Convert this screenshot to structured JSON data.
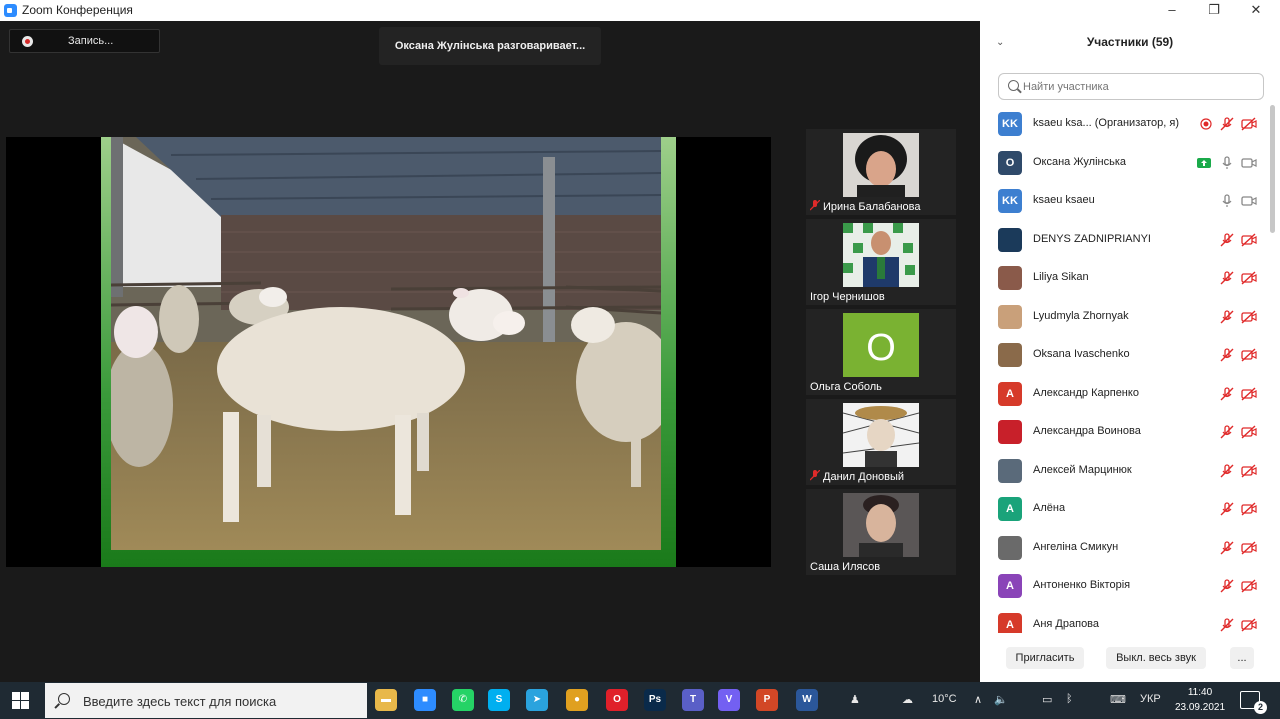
{
  "window": {
    "title": "Zoom Конференция",
    "controls": [
      "–",
      "❐",
      "✕"
    ]
  },
  "meeting": {
    "recording_label": "Запись...",
    "speaking_indicator": "Оксана Жулінська разговаривает..."
  },
  "gallery": [
    {
      "name": "Ирина Балабанова",
      "muted": true,
      "avatar": "photo-woman"
    },
    {
      "name": "Ігор Чернишов",
      "muted": false,
      "avatar": "photo-man-green"
    },
    {
      "name": "Ольга Соболь",
      "muted": false,
      "avatar": "letter",
      "letter": "О",
      "color": "#7ab232"
    },
    {
      "name": "Данил Доновый",
      "muted": true,
      "avatar": "photo-sketch"
    },
    {
      "name": "Саша Илясов",
      "muted": false,
      "avatar": "photo-young-man"
    }
  ],
  "participants_panel": {
    "title": "Участники (59)",
    "search_placeholder": "Найти участника",
    "participants": [
      {
        "name": "ksaeu ksa... (Организатор, я)",
        "initials": "KK",
        "color": "#3d7fd0",
        "recording": true,
        "mic": "muted",
        "video": "off"
      },
      {
        "name": "Оксана Жулінська",
        "initials": "O",
        "color": "#2f4a6a",
        "sharing": true,
        "mic": "on",
        "video": "on"
      },
      {
        "name": "ksaeu ksaeu",
        "initials": "KK",
        "color": "#3d7fd0",
        "mic": "on",
        "video": "on"
      },
      {
        "name": "DENYS ZADNIPRIANYI",
        "initials": "",
        "color": "#1b3a5a",
        "mic": "muted",
        "video": "off"
      },
      {
        "name": "Liliya Sikan",
        "initials": "",
        "color": "#8a5a4a",
        "mic": "muted",
        "video": "off"
      },
      {
        "name": "Lyudmyla Zhornyak",
        "initials": "",
        "color": "#c9a07a",
        "mic": "muted",
        "video": "off"
      },
      {
        "name": "Oksana Ivaschenko",
        "initials": "",
        "color": "#8a6a4a",
        "mic": "muted",
        "video": "off"
      },
      {
        "name": "Александр Карпенко",
        "initials": "А",
        "color": "#d63a2a",
        "mic": "muted",
        "video": "off"
      },
      {
        "name": "Александра Воинова",
        "initials": "",
        "color": "#c8202a",
        "mic": "muted",
        "video": "off"
      },
      {
        "name": "Алексей Марцинюк",
        "initials": "",
        "color": "#5a6a7a",
        "mic": "muted",
        "video": "off"
      },
      {
        "name": "Алёна",
        "initials": "А",
        "color": "#1aa37a",
        "mic": "muted",
        "video": "off"
      },
      {
        "name": "Ангеліна Смикун",
        "initials": "",
        "color": "#6a6a6a",
        "mic": "muted",
        "video": "off"
      },
      {
        "name": "Антоненко Вікторія",
        "initials": "А",
        "color": "#8a44b8",
        "mic": "muted",
        "video": "off"
      },
      {
        "name": "Аня Драпова",
        "initials": "А",
        "color": "#d63a2a",
        "mic": "muted",
        "video": "off"
      }
    ],
    "invite_label": "Пригласить",
    "mute_all_label": "Выкл. весь звук",
    "more_label": "..."
  },
  "taskbar": {
    "search_placeholder": "Введите здесь текст для поиска",
    "apps": [
      {
        "name": "file-explorer",
        "color": "#e8b84a",
        "glyph": "▬"
      },
      {
        "name": "zoom",
        "color": "#2d8cff",
        "glyph": "■"
      },
      {
        "name": "whatsapp",
        "color": "#25d366",
        "glyph": "✆"
      },
      {
        "name": "skype",
        "color": "#00aff0",
        "glyph": "S"
      },
      {
        "name": "telegram",
        "color": "#2aa3de",
        "glyph": "➤"
      },
      {
        "name": "chrome",
        "color": "#e0a020",
        "glyph": "●"
      },
      {
        "name": "opera",
        "color": "#e0202a",
        "glyph": "O"
      },
      {
        "name": "photoshop",
        "color": "#0a2a4a",
        "glyph": "Ps"
      },
      {
        "name": "teams",
        "color": "#5a5fc7",
        "glyph": "T"
      },
      {
        "name": "viber",
        "color": "#7360f2",
        "glyph": "V"
      },
      {
        "name": "powerpoint",
        "color": "#d24726",
        "glyph": "P"
      },
      {
        "name": "word",
        "color": "#2b579a",
        "glyph": "W"
      }
    ],
    "weather": "10°C",
    "language": "УКР",
    "time": "11:40",
    "date": "23.09.2021",
    "notifications": "2"
  }
}
